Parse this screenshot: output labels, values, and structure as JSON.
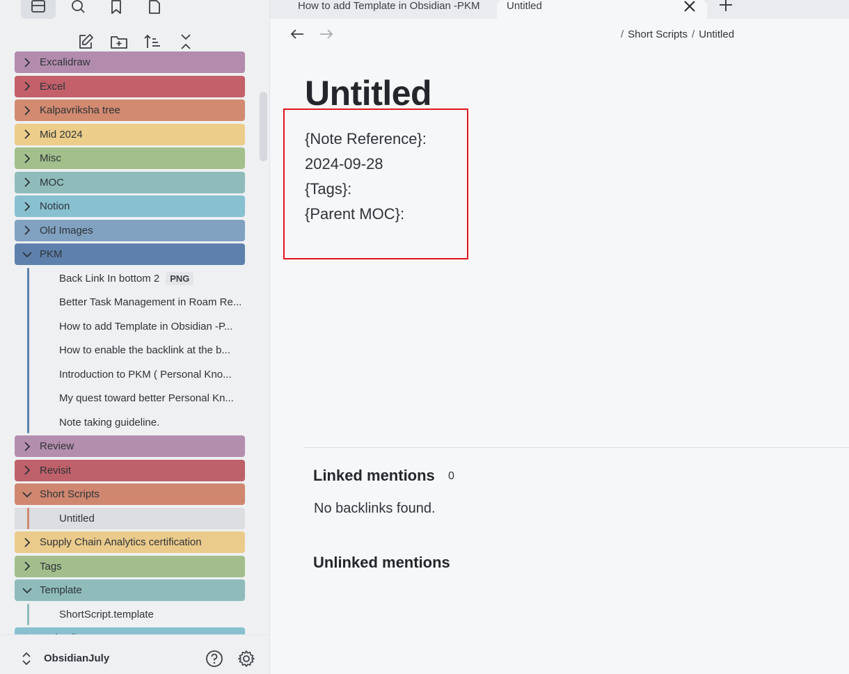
{
  "ribbon": {
    "icons": [
      "files-icon",
      "search-icon",
      "bookmark-icon",
      "page-icon"
    ]
  },
  "file_nav_actions": [
    "new-note-icon",
    "new-folder-icon",
    "sort-icon",
    "collapse-icon"
  ],
  "tree": {
    "folders": [
      {
        "label": "Excalidraw",
        "color": "#b38cad"
      },
      {
        "label": "Excel",
        "color": "#c3606a"
      },
      {
        "label": "Kalpavriksha tree",
        "color": "#d28a70"
      },
      {
        "label": "Mid 2024",
        "color": "#eccd8a"
      },
      {
        "label": "Misc",
        "color": "#a3bf8c"
      },
      {
        "label": "MOC",
        "color": "#8fbcbb"
      },
      {
        "label": "Notion",
        "color": "#88c0d0"
      },
      {
        "label": "Old Images",
        "color": "#81a1c1"
      },
      {
        "label": "PKM",
        "color": "#5e81ac"
      },
      {
        "label": "Review",
        "color": "#b48ead"
      },
      {
        "label": "Revisit",
        "color": "#bf616a"
      },
      {
        "label": "Short Scripts",
        "color": "#d08770"
      },
      {
        "label": "Supply Chain Analytics certification",
        "color": "#ebcb8b"
      },
      {
        "label": "Tags",
        "color": "#a3be8c"
      },
      {
        "label": "Template",
        "color": "#8fbcbb"
      },
      {
        "label": "Web Clips",
        "color": "#88c0d0"
      }
    ],
    "pkm_files": [
      {
        "label": "Back Link In bottom 2",
        "badge": "PNG"
      },
      {
        "label": "Better Task Management in Roam Re..."
      },
      {
        "label": "How to add Template in Obsidian -P..."
      },
      {
        "label": "How to enable the backlink at the b..."
      },
      {
        "label": "Introduction to PKM ( Personal Kno..."
      },
      {
        "label": "My quest toward better Personal Kn..."
      },
      {
        "label": "Note taking guideline."
      }
    ],
    "short_scripts_files": [
      {
        "label": "Untitled"
      }
    ],
    "template_files": [
      {
        "label": "ShortScript.template"
      }
    ]
  },
  "vault": {
    "name": "ObsidianJuly"
  },
  "tabs": [
    {
      "label": "How to add Template in Obsidian -PKM"
    },
    {
      "label": "Untitled"
    }
  ],
  "breadcrumb": {
    "folder": "Short Scripts",
    "file": "Untitled"
  },
  "note": {
    "title": "Untitled",
    "properties": [
      "{Note Reference}:",
      "2024-09-28",
      "{Tags}:",
      "{Parent MOC}:"
    ]
  },
  "backlinks": {
    "linked_title": "Linked mentions",
    "linked_count": "0",
    "linked_empty": "No backlinks found.",
    "unlinked_title": "Unlinked mentions"
  },
  "colors": {
    "highlight_box": "#e0161b"
  }
}
